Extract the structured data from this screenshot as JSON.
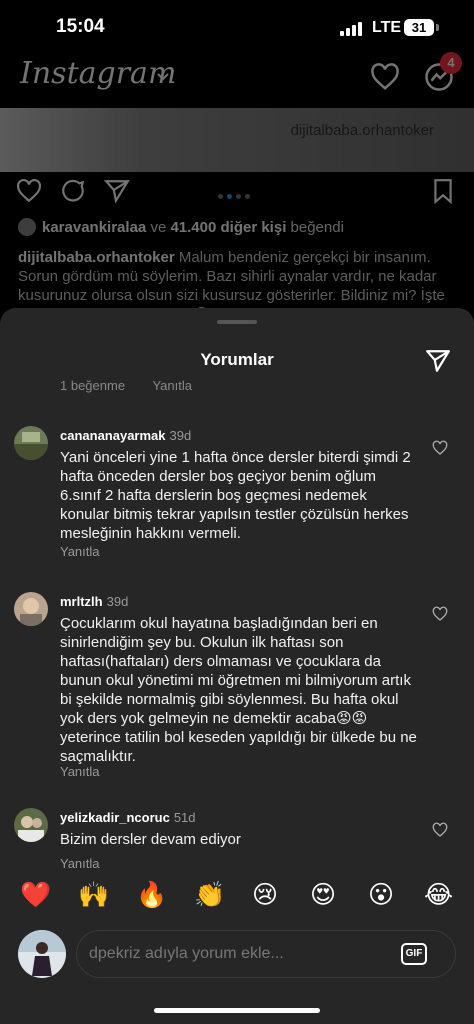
{
  "status_bar": {
    "time": "15:04",
    "network": "LTE",
    "battery": "31"
  },
  "feed": {
    "app_name": "Instagram",
    "message_badge": "4",
    "post_watermark": "dijitalbaba.orhantoker",
    "likes": {
      "user": "karavankiralaa",
      "connector": "ve",
      "others": "41.400 diğer kişi",
      "suffix": "beğendi"
    },
    "caption": {
      "user": "dijitalbaba.orhantoker",
      "text": "Malum bendeniz gerçekçi bir insanım. Sorun gördüm mü söylerim. Bazı sihirli aynalar vardır, ne kadar kusurunuz olursa olsun sizi kusursuz gösterirler. Bildiniz mi? İşte ben o aynalardan değilim. 😊"
    }
  },
  "comments_sheet": {
    "title": "Yorumlar",
    "cut_row": {
      "likes": "1 beğenme",
      "reply": "Yanıtla"
    },
    "comments": [
      {
        "user": "canananayarmak",
        "age": "39d",
        "text": "Yani önceleri yine 1 hafta önce dersler biterdi şimdi 2 hafta önceden dersler boş geçiyor benim oğlum 6.sınıf 2 hafta derslerin boş geçmesi nedemek konular bitmiş tekrar yapılsın testler çözülsün herkes mesleğinin hakkını vermeli.",
        "reply": "Yanıtla"
      },
      {
        "user": "mrltzlh",
        "age": "39d",
        "text": "Çocuklarım okul hayatına başladığından beri en sinirlendiğim şey bu. Okulun ilk haftası son haftası(haftaları) ders olmaması ve çocuklara da bunun okul yönetimi mi öğretmen mi bilmiyorum artık bi şekilde normalmiş gibi söylenmesi. Bu hafta okul yok ders yok gelmeyin ne demektir acaba😡😡yeterince tatilin bol keseden yapıldığı bir ülkede bu ne saçmalıktır.",
        "reply": "Yanıtla"
      },
      {
        "user": "yelizkadir_ncoruc",
        "age": "51d",
        "text": "Bizim dersler devam ediyor",
        "reply": "Yanıtla"
      }
    ],
    "reactions": [
      "❤️",
      "🙌",
      "🔥",
      "👏",
      "😢",
      "😍",
      "😮",
      "😂"
    ],
    "composer": {
      "placeholder": "dpekriz adıyla yorum ekle...",
      "gif_label": "GIF"
    }
  },
  "colors": {
    "sheet_bg": "#262626",
    "badge": "#ff3040",
    "carousel_active": "#3897f0"
  },
  "icons": [
    "heart-icon",
    "messenger-icon",
    "comment-icon",
    "share-icon",
    "bookmark-icon",
    "send-icon",
    "like-heart-icon",
    "chevron-down-icon"
  ]
}
